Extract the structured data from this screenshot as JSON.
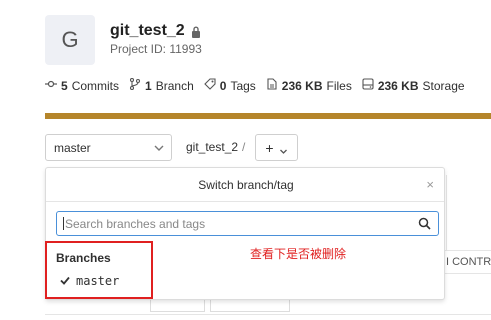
{
  "project": {
    "avatar_letter": "G",
    "name": "git_test_2",
    "id_label": "Project ID: 11993"
  },
  "stats": [
    {
      "icon": "commit-icon",
      "count": "5",
      "label": "Commits"
    },
    {
      "icon": "branch-icon",
      "count": "1",
      "label": "Branch"
    },
    {
      "icon": "tag-icon",
      "count": "0",
      "label": "Tags"
    },
    {
      "icon": "file-icon",
      "count": "236 KB",
      "label": "Files"
    },
    {
      "icon": "storage-icon",
      "count": "236 KB",
      "label": "Storage"
    }
  ],
  "toolbar": {
    "branch_value": "master",
    "breadcrumb": "git_test_2",
    "breadcrumb_sep": "/",
    "add_label": "+"
  },
  "dropdown": {
    "title": "Switch branch/tag",
    "close": "×",
    "search_placeholder": "Search branches and tags",
    "section_header": "Branches",
    "items": [
      {
        "label": "master",
        "selected": true
      }
    ]
  },
  "annotation": "查看下是否被删除",
  "background": {
    "partial_text": "I CONTRI"
  },
  "colors": {
    "accent_bar": "#b5852a",
    "highlight_red": "#e02020",
    "focus_blue": "#4a90d9"
  }
}
